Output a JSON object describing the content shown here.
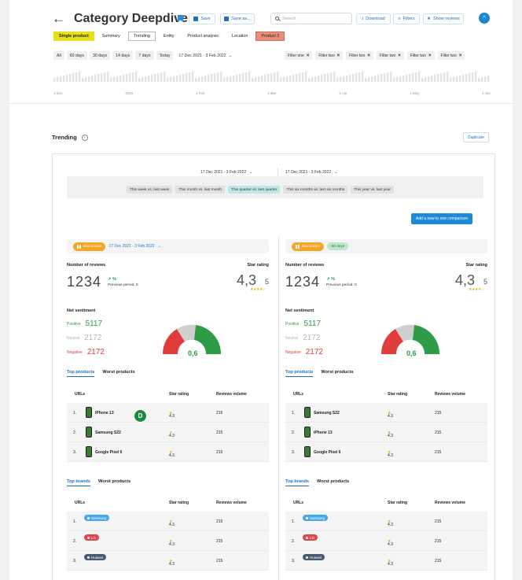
{
  "header": {
    "back_icon": "arrow-left-icon",
    "title": "Category Deepdive",
    "save_label": "Save",
    "save_as_label": "Save as...",
    "search_placeholder": "Search",
    "download_label": "Download",
    "filters_label": "Filters",
    "show_reviews_label": "Show reviews",
    "profile_initial": "^"
  },
  "tabs": [
    "Single product",
    "Summary",
    "Trending",
    "Entity",
    "Product analysis",
    "Location",
    "Product 2"
  ],
  "date_chips": [
    "All",
    "60 days",
    "30 days",
    "14 days",
    "7 days",
    "Today",
    "17 Dec 2021 - 3 Feb 2022"
  ],
  "filter_chips": [
    "Filter one",
    "Filter two",
    "Filter two",
    "Filter two",
    "Filter two",
    "Filter two",
    "Filter two"
  ],
  "timeline_labels": [
    "1 Dec",
    "2022",
    "1 Feb",
    "1 Mar",
    "1 Apr",
    "1 May",
    "1 Jun"
  ],
  "section": {
    "title": "Trending",
    "duplicate_label": "Duplicate"
  },
  "panel": {
    "date_left": "17 Dec 2021 - 3 Feb 2022",
    "date_right": "17 Dec 2021 - 3 Feb 2022",
    "compare_options": [
      "This week vs. last week",
      "This month vs. last month",
      "This quarter vs. last quarter",
      "This six months vs. last six months",
      "This year vs. last year"
    ],
    "add_button": "Add a new to one comparison"
  },
  "left": {
    "category": "Electronics",
    "date": "17 Dec 2021 - 3 Feb 2022",
    "reviews_label": "Number of reviews",
    "reviews_value": "1234",
    "trend_pct": "↗ %",
    "previous": "Previous period: 0",
    "star_label": "Star rating",
    "star_value": "4,3",
    "star_max": "5",
    "stars": "★★★★☆",
    "net_label": "Net sentiment",
    "positive_label": "Positive",
    "positive_value": "5117",
    "neutral_label": "Neutral",
    "neutral_value": "2172",
    "negative_label": "Negative",
    "negative_value": "2172",
    "gauge_value": "0,6"
  },
  "right": {
    "category": "Electronics",
    "period": "60 days",
    "reviews_label": "Number of reviews",
    "reviews_value": "1234",
    "trend_pct": "↗ %",
    "previous": "Previous period: 0",
    "star_label": "Star rating",
    "star_value": "4,3",
    "star_max": "5",
    "stars": "★★★★☆",
    "net_label": "Net sentiment",
    "positive_label": "Positive",
    "positive_value": "5117",
    "neutral_label": "Neutral",
    "neutral_value": "2172",
    "negative_label": "Negative",
    "negative_value": "2172",
    "gauge_value": "0,6"
  },
  "products_tabs": {
    "top": "Top products",
    "worst": "Worst products"
  },
  "brands_tabs": {
    "top": "Top brands",
    "worst": "Worst products"
  },
  "columns": {
    "urls": "URLs",
    "rating": "Star rating",
    "volume": "Reviews volume"
  },
  "left_products": [
    {
      "num": "1.",
      "name": "iPhone 13",
      "rating": "4.3",
      "volume": "215"
    },
    {
      "num": "2.",
      "name": "Samsung S22",
      "rating": "4.3",
      "volume": "215"
    },
    {
      "num": "3.",
      "name": "Google Pixel 6",
      "rating": "4.3",
      "volume": "215"
    }
  ],
  "right_products": [
    {
      "num": "1.",
      "name": "Samsung S22",
      "rating": "4.3",
      "volume": "215"
    },
    {
      "num": "2.",
      "name": "iPhone 13",
      "rating": "4.3",
      "volume": "215"
    },
    {
      "num": "3.",
      "name": "Google Pixel 6",
      "rating": "4.3",
      "volume": "215"
    }
  ],
  "brands": [
    {
      "num": "1.",
      "name": "Samsung",
      "color": "#4aa8e8",
      "rating": "4.3",
      "volume": "215"
    },
    {
      "num": "2.",
      "name": "LG",
      "color": "#e0454c",
      "rating": "4.3",
      "volume": "215"
    },
    {
      "num": "3.",
      "name": "Huawei",
      "color": "#4a5a70",
      "rating": "4.3",
      "volume": "215"
    }
  ],
  "cursor_badge": "D",
  "colors": {
    "accent": "#1c6fc4",
    "positive": "#2e9b46",
    "neutral": "#c9c9c9",
    "negative": "#e03c3c"
  }
}
